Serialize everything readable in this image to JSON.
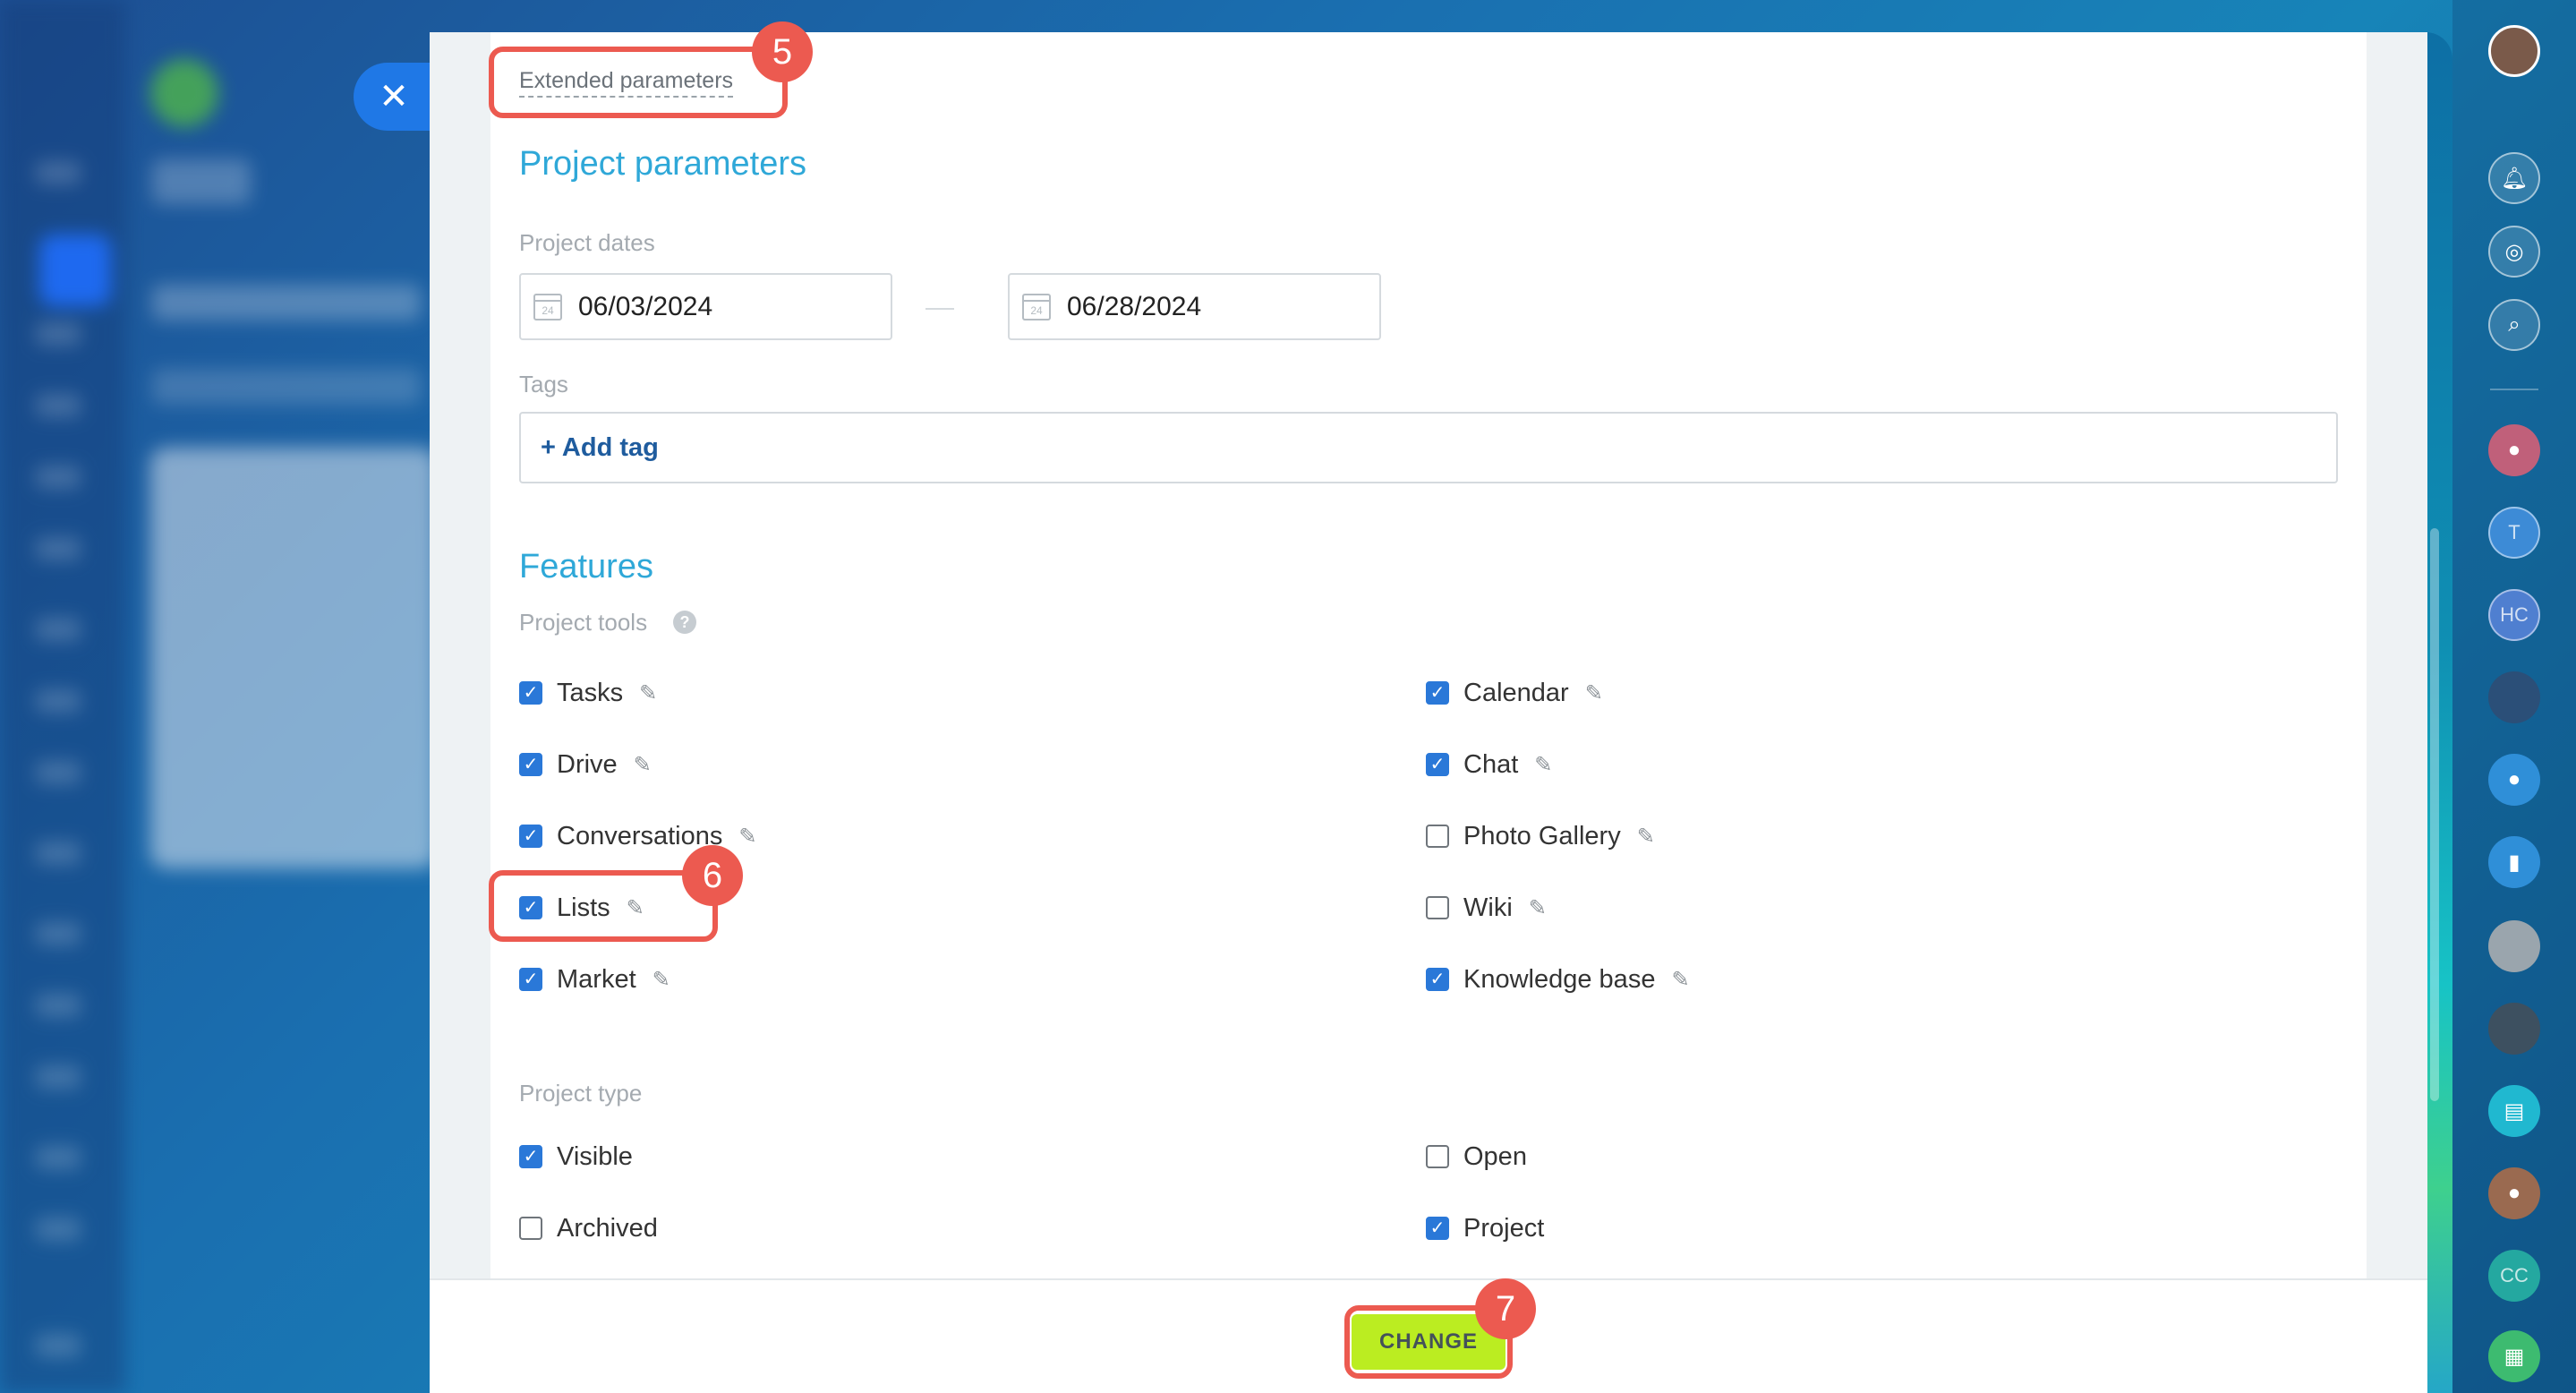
{
  "header": {
    "extended_parameters": "Extended parameters"
  },
  "project_parameters": {
    "title": "Project parameters",
    "dates_label": "Project dates",
    "start_date": "06/03/2024",
    "end_date": "06/28/2024",
    "calendar_icon_day": "24",
    "tags_label": "Tags",
    "add_tag": "+ Add tag"
  },
  "features": {
    "title": "Features",
    "tools_label": "Project tools",
    "help_glyph": "?",
    "tools": [
      {
        "label": "Tasks",
        "checked": true
      },
      {
        "label": "Drive",
        "checked": true
      },
      {
        "label": "Conversations",
        "checked": true
      },
      {
        "label": "Lists",
        "checked": true
      },
      {
        "label": "Market",
        "checked": true
      },
      {
        "label": "Calendar",
        "checked": true
      },
      {
        "label": "Chat",
        "checked": true
      },
      {
        "label": "Photo Gallery",
        "checked": false
      },
      {
        "label": "Wiki",
        "checked": false
      },
      {
        "label": "Knowledge base",
        "checked": true
      }
    ],
    "type_label": "Project type",
    "types": [
      {
        "label": "Visible",
        "checked": true
      },
      {
        "label": "Archived",
        "checked": false
      },
      {
        "label": "Open",
        "checked": false
      },
      {
        "label": "Project",
        "checked": true
      }
    ]
  },
  "footer": {
    "change_button": "CHANGE"
  },
  "annotations": [
    "5",
    "6",
    "7"
  ],
  "icons": {
    "close": "close-icon",
    "check": "checkmark-icon",
    "edit": "pencil-icon",
    "calendar": "calendar-icon",
    "help": "help-icon"
  },
  "rail": {
    "initials_t": "T",
    "initials_hc": "HC",
    "initials_cc": "CC"
  },
  "colors": {
    "accent_title": "#2fa8d8",
    "checkbox": "#2a78d8",
    "change_button": "#bbed21",
    "annotation": "#ec5a50",
    "link": "#1f5c9e"
  }
}
